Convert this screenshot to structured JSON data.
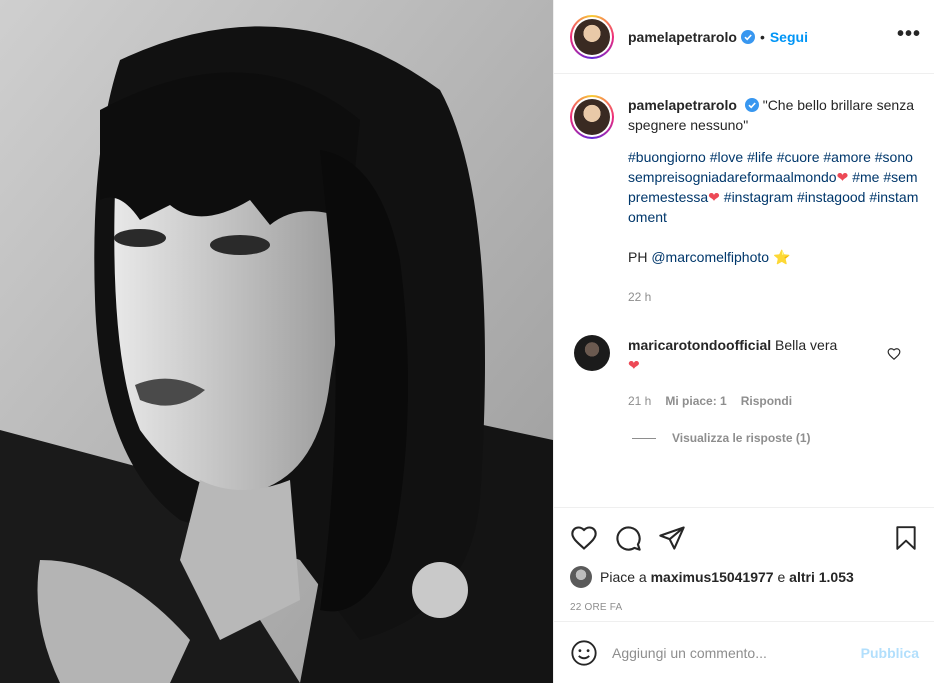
{
  "post": {
    "author": "pamelapetrarolo",
    "follow_label": "Segui",
    "dot": "•",
    "more_label": "•••"
  },
  "caption": {
    "username": "pamelapetrarolo",
    "text": "\"Che bello brillare senza spegnere nessuno\"",
    "hashtags": [
      "#buongiorno",
      "#love",
      "#life",
      "#cuore",
      "#amore",
      "#sonosempreisogniadareformaalmondo",
      "#me",
      "#sempremestessa",
      "#instagram",
      "#instagood",
      "#instamoment"
    ],
    "heart": "❤",
    "credit_prefix": "PH",
    "credit_mention": "@marcomelfiphoto",
    "star": "⭐",
    "time": "22 h"
  },
  "comment": {
    "username": "maricarotondoofficial",
    "text": "Bella vera",
    "heart": "❤",
    "time": "21 h",
    "likes": "Mi piace: 1",
    "reply": "Rispondi",
    "view_replies": "Visualizza le risposte (1)"
  },
  "likes": {
    "prefix": "Piace a",
    "user": "maximus15041977",
    "middle": "e",
    "others": "altri 1.053"
  },
  "posted_ago": "22 ore fa",
  "add_comment": {
    "placeholder": "Aggiungi un commento...",
    "publish_label": "Pubblica"
  },
  "colors": {
    "link": "#0095f6",
    "hashtag": "#00376b",
    "heart": "#ed4956",
    "publish_disabled": "#b2dffc",
    "muted": "#8e8e8e"
  },
  "icons": [
    "verified-badge-icon",
    "more-options-icon",
    "heart-icon",
    "comment-icon",
    "share-icon",
    "bookmark-icon",
    "emoji-icon"
  ]
}
